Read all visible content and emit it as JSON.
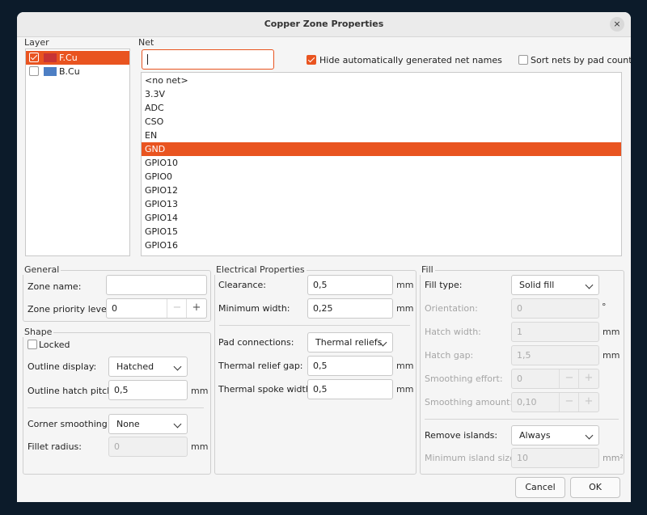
{
  "window": {
    "title": "Copper Zone Properties"
  },
  "layer": {
    "group_label": "Layer",
    "items": [
      {
        "name": "F.Cu",
        "checked": true,
        "selected": true,
        "color": "#c83434"
      },
      {
        "name": "B.Cu",
        "checked": false,
        "selected": false,
        "color": "#4d7fc4"
      }
    ]
  },
  "net": {
    "group_label": "Net",
    "filter_value": "",
    "hide_auto_label": "Hide automatically generated net names",
    "hide_auto_checked": true,
    "sort_label": "Sort nets by pad count",
    "sort_checked": false,
    "items": [
      "<no net>",
      "3.3V",
      "ADC",
      "CSO",
      "EN",
      "GND",
      "GPIO10",
      "GPIO0",
      "GPIO12",
      "GPIO13",
      "GPIO14",
      "GPIO15",
      "GPIO16"
    ],
    "selected": "GND"
  },
  "general": {
    "group_label": "General",
    "zone_name_label": "Zone name:",
    "zone_name_value": "",
    "priority_label": "Zone priority level:",
    "priority_value": "0"
  },
  "shape": {
    "group_label": "Shape",
    "locked_label": "Locked",
    "locked_checked": false,
    "outline_display_label": "Outline display:",
    "outline_display_value": "Hatched",
    "hatch_pitch_label": "Outline hatch pitch:",
    "hatch_pitch_value": "0,5",
    "hatch_pitch_unit": "mm",
    "corner_label": "Corner smoothing:",
    "corner_value": "None",
    "fillet_label": "Fillet radius:",
    "fillet_value": "0",
    "fillet_unit": "mm"
  },
  "electrical": {
    "group_label": "Electrical Properties",
    "clearance_label": "Clearance:",
    "clearance_value": "0,5",
    "clearance_unit": "mm",
    "min_width_label": "Minimum width:",
    "min_width_value": "0,25",
    "min_width_unit": "mm",
    "pad_conn_label": "Pad connections:",
    "pad_conn_value": "Thermal reliefs",
    "relief_gap_label": "Thermal relief gap:",
    "relief_gap_value": "0,5",
    "relief_gap_unit": "mm",
    "spoke_label": "Thermal spoke width:",
    "spoke_value": "0,5",
    "spoke_unit": "mm"
  },
  "fill": {
    "group_label": "Fill",
    "fill_type_label": "Fill type:",
    "fill_type_value": "Solid fill",
    "orientation_label": "Orientation:",
    "orientation_value": "0",
    "orientation_unit": "°",
    "hatch_width_label": "Hatch width:",
    "hatch_width_value": "1",
    "hatch_width_unit": "mm",
    "hatch_gap_label": "Hatch gap:",
    "hatch_gap_value": "1,5",
    "hatch_gap_unit": "mm",
    "smoothing_effort_label": "Smoothing effort:",
    "smoothing_effort_value": "0",
    "smoothing_amount_label": "Smoothing amount:",
    "smoothing_amount_value": "0,10",
    "remove_islands_label": "Remove islands:",
    "remove_islands_value": "Always",
    "min_island_label": "Minimum island size:",
    "min_island_value": "10",
    "min_island_unit": "mm²"
  },
  "buttons": {
    "cancel": "Cancel",
    "ok": "OK"
  },
  "spin": {
    "minus": "−",
    "plus": "+"
  },
  "icons": {
    "close": "×"
  },
  "colors": {
    "accent": "#e95420"
  }
}
